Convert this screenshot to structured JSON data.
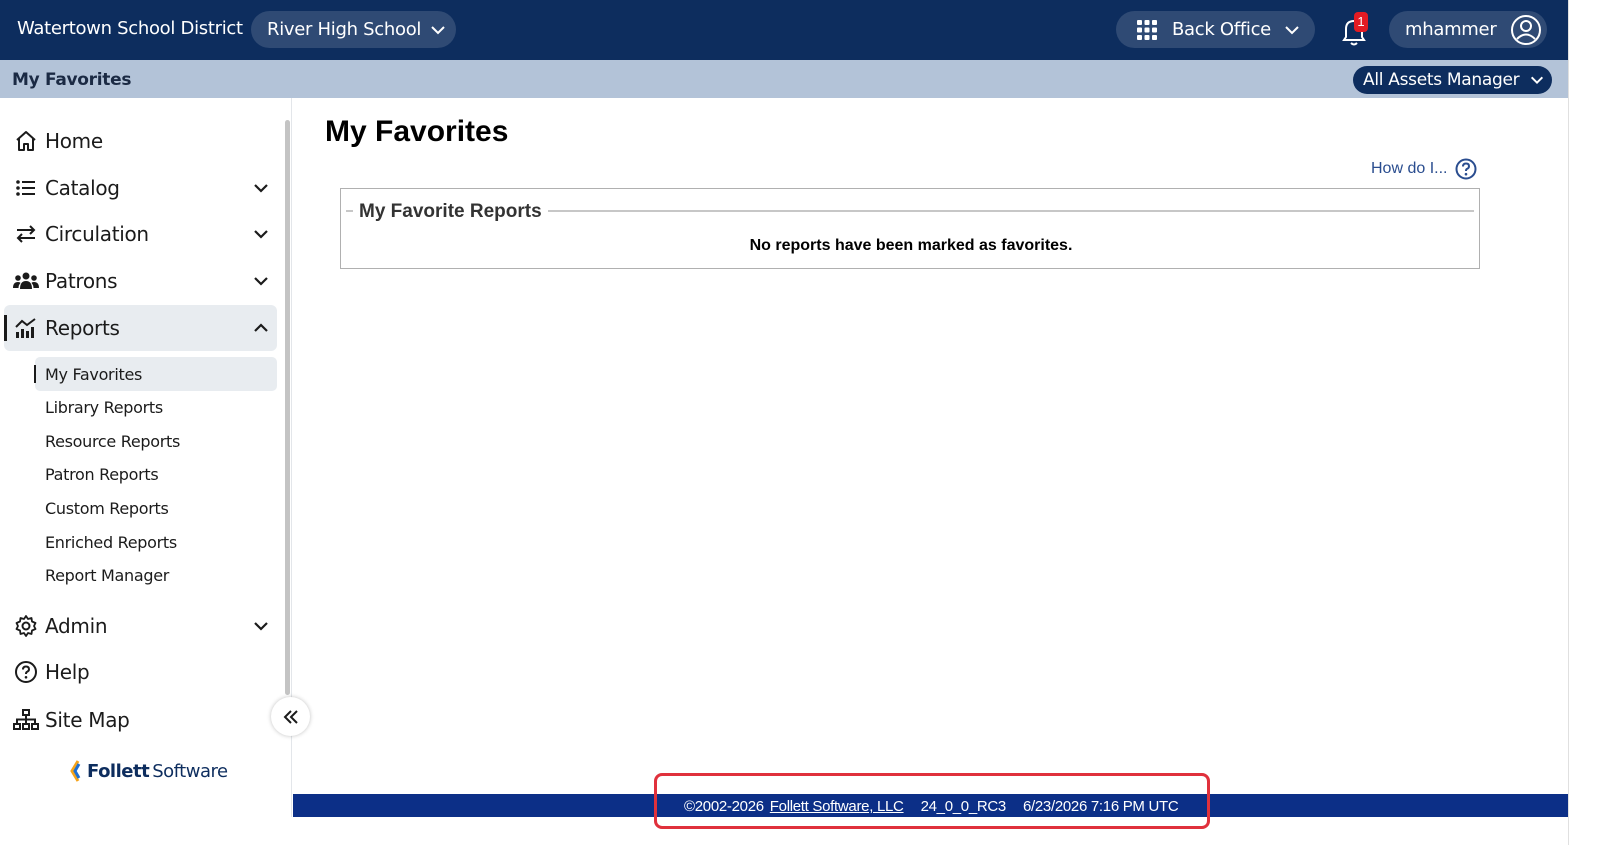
{
  "header": {
    "district": "Watertown School District",
    "school": "River High School",
    "app_switcher": "Back Office",
    "notification_count": "1",
    "username": "mhammer"
  },
  "subheader": {
    "title": "My Favorites",
    "role": "All Assets Manager"
  },
  "sidebar": {
    "items": [
      {
        "label": "Home",
        "icon": "home-icon"
      },
      {
        "label": "Catalog",
        "icon": "list-icon"
      },
      {
        "label": "Circulation",
        "icon": "arrows-exchange-icon"
      },
      {
        "label": "Patrons",
        "icon": "people-icon"
      },
      {
        "label": "Reports",
        "icon": "chart-icon"
      },
      {
        "label": "Admin",
        "icon": "gear-icon"
      },
      {
        "label": "Help",
        "icon": "question-icon"
      },
      {
        "label": "Site Map",
        "icon": "sitemap-icon"
      }
    ],
    "reports_sub": [
      "My Favorites",
      "Library Reports",
      "Resource Reports",
      "Patron Reports",
      "Custom Reports",
      "Enriched Reports",
      "Report Manager"
    ],
    "brand_bold": "Follett",
    "brand_rest": "Software"
  },
  "main": {
    "title": "My Favorites",
    "help_link": "How do I...",
    "section_title": "My Favorite Reports",
    "empty_message": "No reports have been marked as favorites."
  },
  "footer": {
    "copyright": "©2002-2026",
    "company_link": "Follett Software, LLC",
    "version": "24_0_0_RC3",
    "timestamp": "6/23/2026 7:16 PM UTC"
  },
  "colors": {
    "header_bg": "#0d2d5e",
    "subheader_bg": "#b3c3d8",
    "footer_bg": "#0c2f87",
    "highlight": "#e0313c",
    "badge": "#e31b23"
  }
}
